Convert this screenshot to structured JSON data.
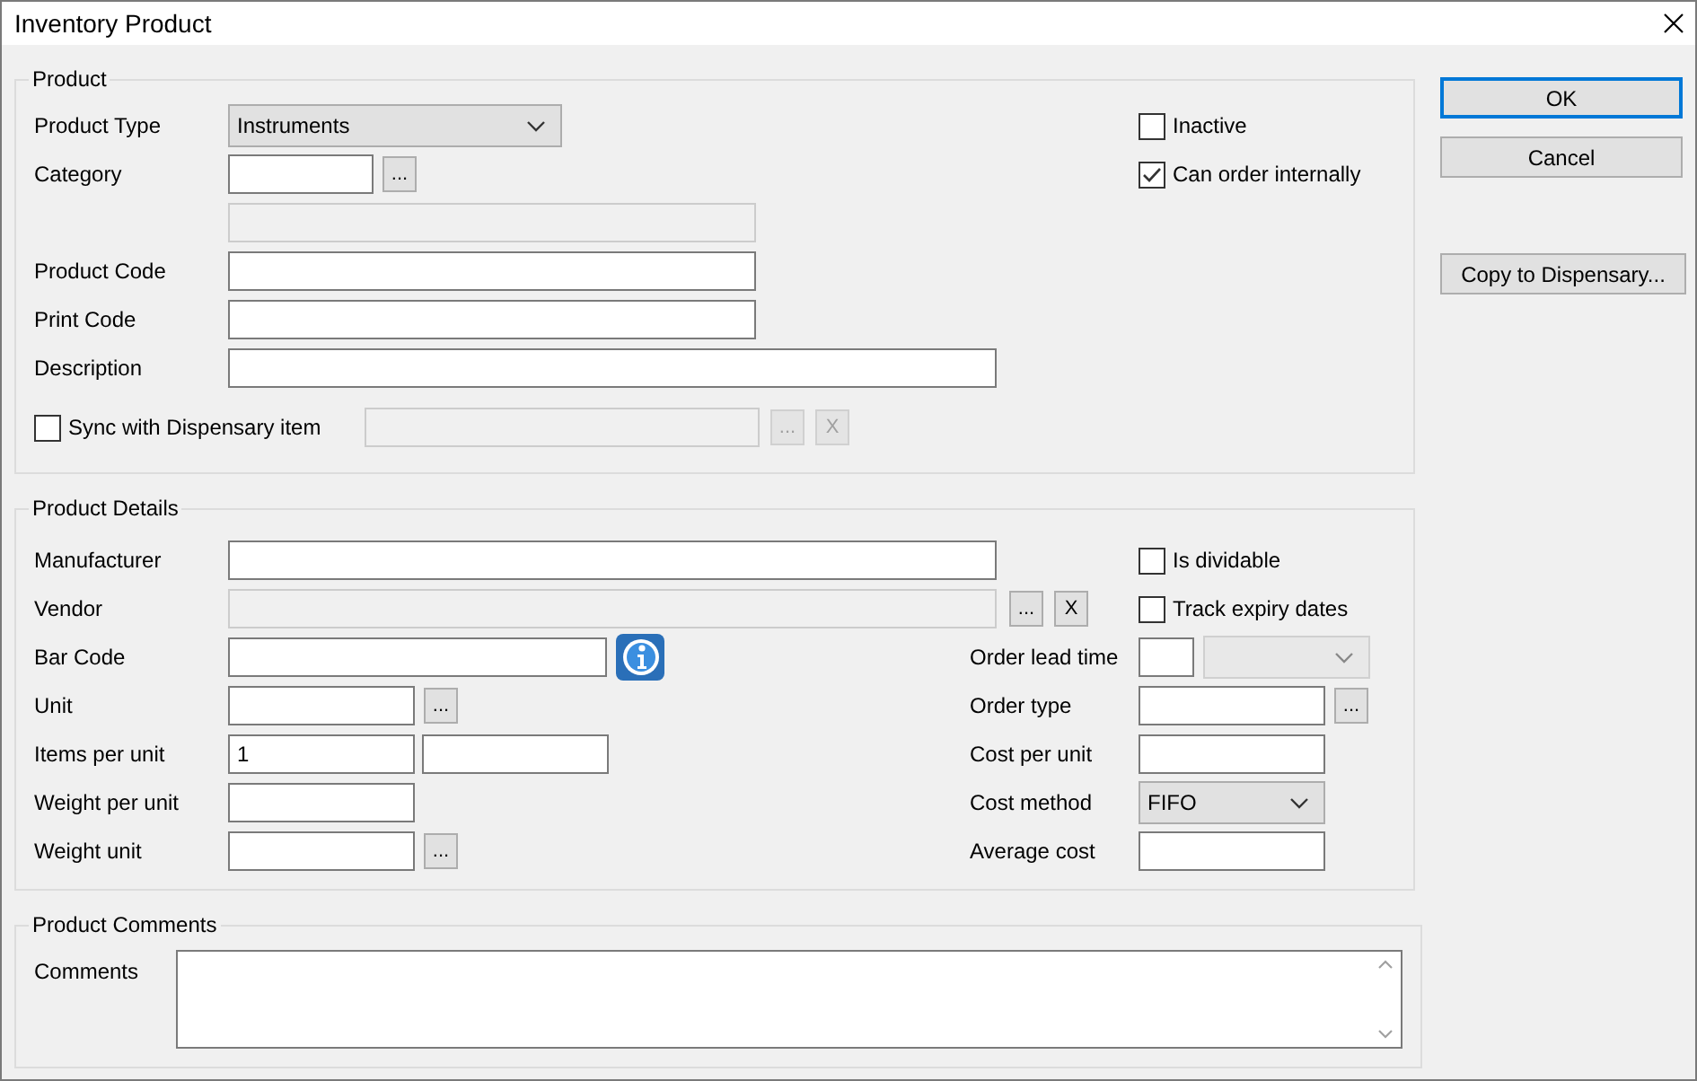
{
  "window": {
    "title": "Inventory Product"
  },
  "product": {
    "legend": "Product",
    "product_type": {
      "label": "Product Type",
      "value": "Instruments"
    },
    "category": {
      "label": "Category",
      "button": "..."
    },
    "category_name": {
      "disabled": true
    },
    "product_code": {
      "label": "Product Code"
    },
    "print_code": {
      "label": "Print Code"
    },
    "description": {
      "label": "Description"
    },
    "sync": {
      "label": "Sync with Dispensary item",
      "checked": false,
      "disabled": true,
      "button": "...",
      "clear": "X"
    },
    "options": [
      {
        "label": "Inactive",
        "checked": false
      },
      {
        "label": "Can order internally",
        "checked": true
      }
    ]
  },
  "details": {
    "legend": "Product Details",
    "manufacturer": {
      "label": "Manufacturer"
    },
    "vendor": {
      "label": "Vendor",
      "disabled": true,
      "button": "...",
      "clear": "X"
    },
    "bar_code": {
      "label": "Bar Code"
    },
    "unit": {
      "label": "Unit",
      "button": "..."
    },
    "items_per_unit": {
      "label": "Items per unit",
      "value": "1"
    },
    "weight_per_unit": {
      "label": "Weight per unit"
    },
    "weight_unit": {
      "label": "Weight unit",
      "button": "..."
    },
    "options": [
      {
        "label": "Is dividable",
        "checked": false
      },
      {
        "label": "Track expiry dates",
        "checked": false
      }
    ],
    "order_lead_time": {
      "label": "Order lead time",
      "unit_disabled": true
    },
    "order_type": {
      "label": "Order type",
      "button": "..."
    },
    "cost_per_unit": {
      "label": "Cost per unit"
    },
    "cost_method": {
      "label": "Cost method",
      "value": "FIFO"
    },
    "average_cost": {
      "label": "Average cost"
    }
  },
  "comments": {
    "legend": "Product Comments",
    "label": "Comments"
  },
  "buttons": [
    {
      "label": "OK",
      "default": true
    },
    {
      "label": "Cancel",
      "default": false
    },
    {
      "label": "Copy to Dispensary...",
      "default": false
    }
  ]
}
